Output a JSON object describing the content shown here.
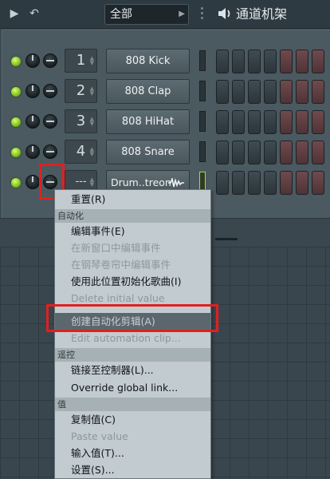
{
  "toolbar": {
    "play_icon": "play-icon",
    "undo_icon": "undo-icon",
    "filter_value": "全部",
    "title": "通道机架"
  },
  "channels": [
    {
      "index": "1",
      "name": "808 Kick"
    },
    {
      "index": "2",
      "name": "808 Clap"
    },
    {
      "index": "3",
      "name": "808 HiHat"
    },
    {
      "index": "4",
      "name": "808 Snare"
    },
    {
      "index": "---",
      "name": "Drum..treon"
    }
  ],
  "context_menu": {
    "reset": "重置(R)",
    "section_automation": "自动化",
    "edit_events": "编辑事件(E)",
    "edit_events_new_window": "在新窗口中编辑事件",
    "edit_events_piano_roll": "在钢琴卷帘中编辑事件",
    "init_song_here": "使用此位置初始化歌曲(I)",
    "delete_initial_value": "Delete initial value",
    "create_automation_clip": "创建自动化剪辑(A)",
    "edit_automation_clip": "Edit automation clip...",
    "section_remote": "遥控",
    "link_to_controller": "链接至控制器(L)...",
    "override_global_link": "Override global link...",
    "section_value": "值",
    "copy_value": "复制值(C)",
    "paste_value": "Paste value",
    "type_in_value": "输入值(T)...",
    "settings": "设置(S)..."
  },
  "colors": {
    "highlight": "#e02020",
    "led": "#7fc020"
  }
}
